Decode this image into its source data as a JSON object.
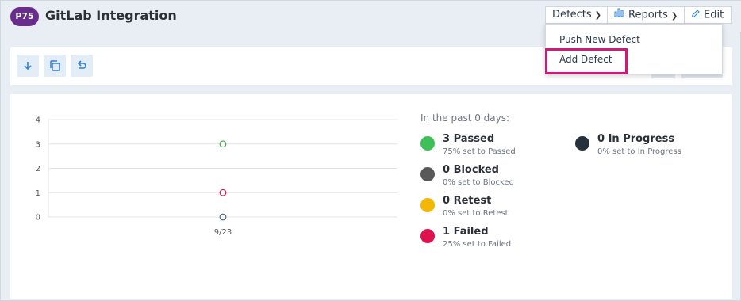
{
  "header": {
    "project_badge": "P75",
    "title": "GitLab Integration",
    "defects_label": "Defects",
    "reports_label": "Reports",
    "edit_label": "Edit"
  },
  "defects_menu": {
    "items": [
      "Push New Defect",
      "Add Defect"
    ],
    "highlighted": "Add Defect"
  },
  "toolbar": {
    "buttons": [
      "download-icon",
      "copy-icon",
      "undo-icon"
    ]
  },
  "summary": {
    "period_text": "In the past 0 days:",
    "stats": [
      {
        "label": "3 Passed",
        "sub": "75% set to Passed",
        "color": "#3fbf57"
      },
      {
        "label": "0 Blocked",
        "sub": "0% set to Blocked",
        "color": "#595959"
      },
      {
        "label": "0 Retest",
        "sub": "0% set to Retest",
        "color": "#f2b705"
      },
      {
        "label": "1 Failed",
        "sub": "25% set to Failed",
        "color": "#e0114f"
      },
      {
        "label": "0 In Progress",
        "sub": "0% set to In Progress",
        "color": "#25313b"
      }
    ]
  },
  "chart_data": {
    "type": "scatter",
    "categories": [
      "9/23"
    ],
    "yticks": [
      "4",
      "3",
      "2",
      "1",
      "0"
    ],
    "ylim": [
      0,
      4
    ],
    "grid": true,
    "series": [
      {
        "values": [
          3
        ],
        "color": "#3fa34d"
      },
      {
        "values": [
          1
        ],
        "color": "#c21d4a"
      },
      {
        "values": [
          0
        ],
        "color": "#4b6b86"
      }
    ]
  },
  "colors": {
    "accent": "#d6177a",
    "badge": "#6b2c8f",
    "toolbar_button": "#e3edf8",
    "toolbar_icon": "#2f7fd4"
  }
}
